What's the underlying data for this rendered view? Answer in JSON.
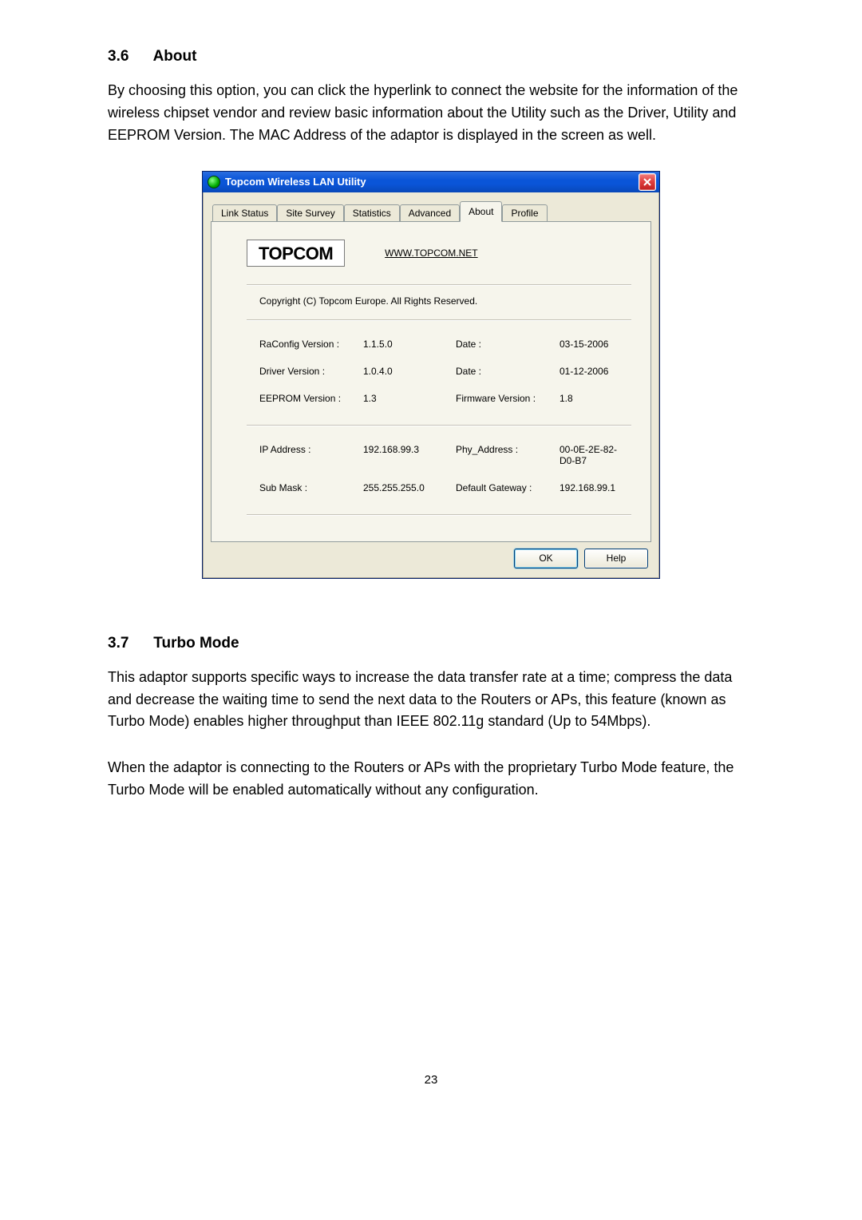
{
  "section1": {
    "number": "3.6",
    "title": "About",
    "paragraph": "By choosing this option, you can click the hyperlink to connect the website for the information of the wireless chipset vendor and review basic information about the Utility such as the Driver, Utility and EEPROM Version. The MAC Address of the adaptor is displayed in the screen as well."
  },
  "dialog": {
    "title": "Topcom Wireless LAN Utility",
    "tabs": [
      "Link Status",
      "Site Survey",
      "Statistics",
      "Advanced",
      "About",
      "Profile"
    ],
    "active_tab": "About",
    "brand": "TOPCOM",
    "site_url": "WWW.TOPCOM.NET",
    "copyright": "Copyright (C) Topcom Europe. All Rights Reserved.",
    "rows": [
      {
        "a": "RaConfig Version :",
        "b": "1.1.5.0",
        "c": "Date :",
        "d": "03-15-2006"
      },
      {
        "a": "Driver Version :",
        "b": "1.0.4.0",
        "c": "Date :",
        "d": "01-12-2006"
      },
      {
        "a": "EEPROM Version :",
        "b": "1.3",
        "c": "Firmware Version :",
        "d": "1.8"
      }
    ],
    "rows2": [
      {
        "a": "IP Address :",
        "b": "192.168.99.3",
        "c": "Phy_Address :",
        "d": "00-0E-2E-82-D0-B7"
      },
      {
        "a": "Sub Mask :",
        "b": "255.255.255.0",
        "c": "Default Gateway :",
        "d": "192.168.99.1"
      }
    ],
    "ok_label": "OK",
    "help_label": "Help"
  },
  "section2": {
    "number": "3.7",
    "title": "Turbo Mode",
    "paragraph1": "This adaptor supports specific ways to increase the data transfer rate at a time; compress the data and decrease the waiting time to send the next data to the Routers or APs, this feature (known as Turbo Mode) enables higher throughput than IEEE 802.11g standard (Up to 54Mbps).",
    "paragraph2": "When the adaptor is connecting to the Routers or APs with the proprietary Turbo Mode feature, the Turbo Mode will be enabled automatically without any configuration."
  },
  "page_number": "23"
}
